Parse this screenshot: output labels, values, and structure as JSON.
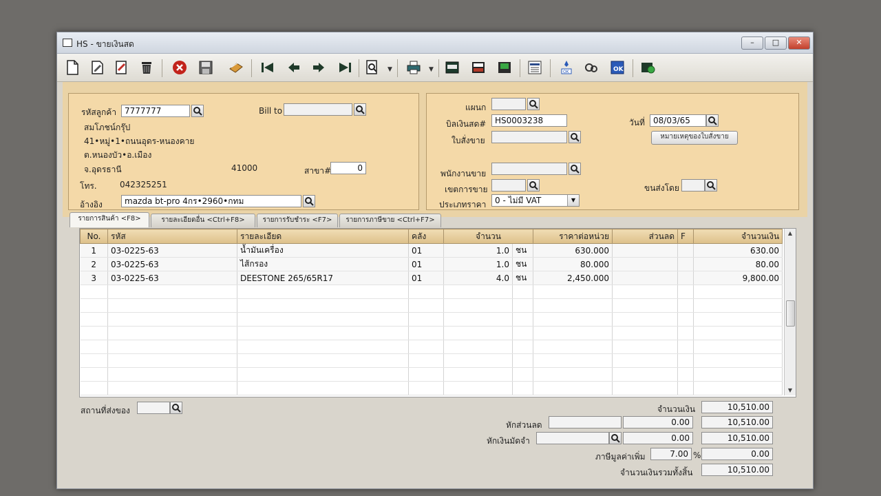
{
  "window": {
    "title": "HS - ขายเงินสด",
    "min": "–",
    "max": "□",
    "close": "✕"
  },
  "toolbar": {
    "icons": [
      "new-doc-icon",
      "edit-icon",
      "copy-icon",
      "delete-icon",
      "cancel-icon",
      "save-icon",
      "print-preview-icon",
      "first-record-icon",
      "prev-record-icon",
      "next-record-icon",
      "last-record-icon",
      "search-doc-icon",
      "printer-icon",
      "report-icon",
      "report2-icon",
      "export-icon",
      "calc-icon",
      "approve-icon",
      "tools-icon",
      "ok-icon",
      "settings-icon"
    ]
  },
  "customer": {
    "code_label": "รหัสลูกค้า",
    "code": "7777777",
    "billto_label": "Bill to",
    "billto": "",
    "name": "สมโภชน์กรุ๊ป",
    "addr1": "41•หมู่•1•ถนนอุดร-หนองคาย",
    "addr2": "ต.หนองบัว•อ.เมือง",
    "addr3": "จ.อุดรธานี",
    "zip": "41000",
    "branch_label": "สาขา#",
    "branch": "0",
    "phone_label": "โทร.",
    "phone": "042325251",
    "ref_label": "อ้างอิง",
    "ref": "mazda bt-pro 4กร•2960•กทม"
  },
  "doc": {
    "dept_label": "แผนก",
    "dept": "",
    "bill_label": "บิลเงินสด#",
    "bill": "HS0003238",
    "date_label": "วันที่",
    "date": "08/03/65",
    "order_label": "ใบสั่งขาย",
    "order": "",
    "order_note_btn": "หมายเหตุของใบสั่งขาย",
    "salesman_label": "พนักงานขาย",
    "salesman": "",
    "zone_label": "เขตการขาย",
    "zone": "",
    "ship_by_label": "ขนส่งโดย",
    "ship_by": "",
    "price_type_label": "ประเภทราคา",
    "price_type": "0 - ไม่มี VAT"
  },
  "tabs": [
    {
      "label": "รายการสินค้า <F8>"
    },
    {
      "label": "รายละเอียดอื่น <Ctrl+F8>"
    },
    {
      "label": "รายการรับชำระ <F7>"
    },
    {
      "label": "รายการภาษีขาย <Ctrl+F7>"
    }
  ],
  "grid": {
    "headers": [
      "No.",
      "รหัส",
      "รายละเอียด",
      "คลัง",
      "จำนวน",
      "",
      "ราคาต่อหน่วย",
      "ส่วนลด",
      "F",
      "จำนวนเงิน"
    ],
    "rows": [
      [
        "1",
        "03-0225-63",
        "น้ำมันเครื่อง",
        "01",
        "1.0",
        "ชน",
        "630.000",
        "",
        "",
        "630.00"
      ],
      [
        "2",
        "03-0225-63",
        "ไส้กรอง",
        "01",
        "1.0",
        "ชน",
        "80.000",
        "",
        "",
        "80.00"
      ],
      [
        "3",
        "03-0225-63",
        "DEESTONE 265/65R17",
        "01",
        "4.0",
        "ชน",
        "2,450.000",
        "",
        "",
        "9,800.00"
      ]
    ],
    "empty_rows": 8
  },
  "footer": {
    "ship_place_label": "สถานที่ส่งของ",
    "ship_place": "",
    "amount_label": "จำนวนเงิน",
    "amount": "10,510.00",
    "discount_label": "หักส่วนลด",
    "discount_text": "",
    "discount_value": "0.00",
    "discount_total": "10,510.00",
    "deposit_label": "หักเงินมัดจำ",
    "deposit_text": "",
    "deposit_value": "0.00",
    "deposit_total": "10,510.00",
    "vat_label": "ภาษีมูลค่าเพิ่ม",
    "vat_rate": "7.00",
    "vat_pct": "%",
    "vat_value": "0.00",
    "grand_label": "จำนวนเงินรวมทั้งสิ้น",
    "grand_total": "10,510.00"
  }
}
